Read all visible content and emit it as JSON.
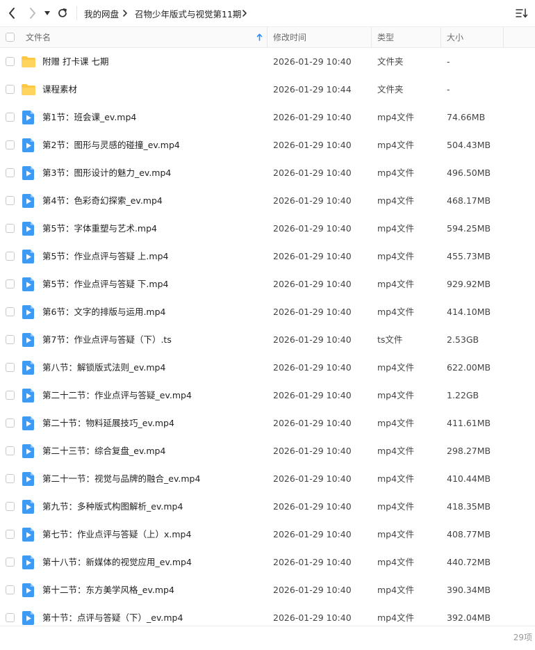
{
  "toolbar": {
    "breadcrumb": [
      "我的网盘",
      "召物少年版式与视觉第11期"
    ]
  },
  "header": {
    "name": "文件名",
    "modified": "修改时间",
    "type": "类型",
    "size": "大小"
  },
  "files": [
    {
      "icon": "folder-icon",
      "name": "附赠 打卡课 七期",
      "modified": "2026-01-29 10:40",
      "type": "文件夹",
      "size": "-"
    },
    {
      "icon": "folder-icon",
      "name": "课程素材",
      "modified": "2026-01-29 10:44",
      "type": "文件夹",
      "size": "-"
    },
    {
      "icon": "video-file-icon",
      "name": "第1节：班会课_ev.mp4",
      "modified": "2026-01-29 10:40",
      "type": "mp4文件",
      "size": "74.66MB"
    },
    {
      "icon": "video-file-icon",
      "name": "第2节：图形与灵感的碰撞_ev.mp4",
      "modified": "2026-01-29 10:40",
      "type": "mp4文件",
      "size": "504.43MB"
    },
    {
      "icon": "video-file-icon",
      "name": "第3节：图形设计的魅力_ev.mp4",
      "modified": "2026-01-29 10:40",
      "type": "mp4文件",
      "size": "496.50MB"
    },
    {
      "icon": "video-file-icon",
      "name": "第4节：色彩奇幻探索_ev.mp4",
      "modified": "2026-01-29 10:40",
      "type": "mp4文件",
      "size": "468.17MB"
    },
    {
      "icon": "video-file-icon",
      "name": "第5节：字体重塑与艺术.mp4",
      "modified": "2026-01-29 10:40",
      "type": "mp4文件",
      "size": "594.25MB"
    },
    {
      "icon": "video-file-icon",
      "name": "第5节：作业点评与答疑 上.mp4",
      "modified": "2026-01-29 10:40",
      "type": "mp4文件",
      "size": "455.73MB"
    },
    {
      "icon": "video-file-icon",
      "name": "第5节：作业点评与答疑 下.mp4",
      "modified": "2026-01-29 10:40",
      "type": "mp4文件",
      "size": "929.92MB"
    },
    {
      "icon": "video-file-icon",
      "name": "第6节：文字的排版与运用.mp4",
      "modified": "2026-01-29 10:40",
      "type": "mp4文件",
      "size": "414.10MB"
    },
    {
      "icon": "video-file-icon",
      "name": "第7节：作业点评与答疑（下）.ts",
      "modified": "2026-01-29 10:40",
      "type": "ts文件",
      "size": "2.53GB"
    },
    {
      "icon": "video-file-icon",
      "name": "第八节：解锁版式法则_ev.mp4",
      "modified": "2026-01-29 10:40",
      "type": "mp4文件",
      "size": "622.00MB"
    },
    {
      "icon": "video-file-icon",
      "name": "第二十二节：作业点评与答疑_ev.mp4",
      "modified": "2026-01-29 10:40",
      "type": "mp4文件",
      "size": "1.22GB"
    },
    {
      "icon": "video-file-icon",
      "name": "第二十节：物料延展技巧_ev.mp4",
      "modified": "2026-01-29 10:40",
      "type": "mp4文件",
      "size": "411.61MB"
    },
    {
      "icon": "video-file-icon",
      "name": "第二十三节：综合复盘_ev.mp4",
      "modified": "2026-01-29 10:40",
      "type": "mp4文件",
      "size": "298.27MB"
    },
    {
      "icon": "video-file-icon",
      "name": "第二十一节：视觉与品牌的融合_ev.mp4",
      "modified": "2026-01-29 10:40",
      "type": "mp4文件",
      "size": "410.44MB"
    },
    {
      "icon": "video-file-icon",
      "name": "第九节：多种版式构图解析_ev.mp4",
      "modified": "2026-01-29 10:40",
      "type": "mp4文件",
      "size": "418.35MB"
    },
    {
      "icon": "video-file-icon",
      "name": "第七节：作业点评与答疑（上）x.mp4",
      "modified": "2026-01-29 10:40",
      "type": "mp4文件",
      "size": "408.77MB"
    },
    {
      "icon": "video-file-icon",
      "name": "第十八节：新媒体的视觉应用_ev.mp4",
      "modified": "2026-01-29 10:40",
      "type": "mp4文件",
      "size": "440.72MB"
    },
    {
      "icon": "video-file-icon",
      "name": "第十二节：东方美学风格_ev.mp4",
      "modified": "2026-01-29 10:40",
      "type": "mp4文件",
      "size": "390.34MB"
    },
    {
      "icon": "video-file-icon",
      "name": "第十节：点评与答疑（下）_ev.mp4",
      "modified": "2026-01-29 10:40",
      "type": "mp4文件",
      "size": "392.04MB"
    }
  ],
  "footer": {
    "count": "29项"
  },
  "colors": {
    "folder": "#ffc844",
    "video": "#3d9bf5",
    "sort_arrow": "#2a8cf0"
  }
}
